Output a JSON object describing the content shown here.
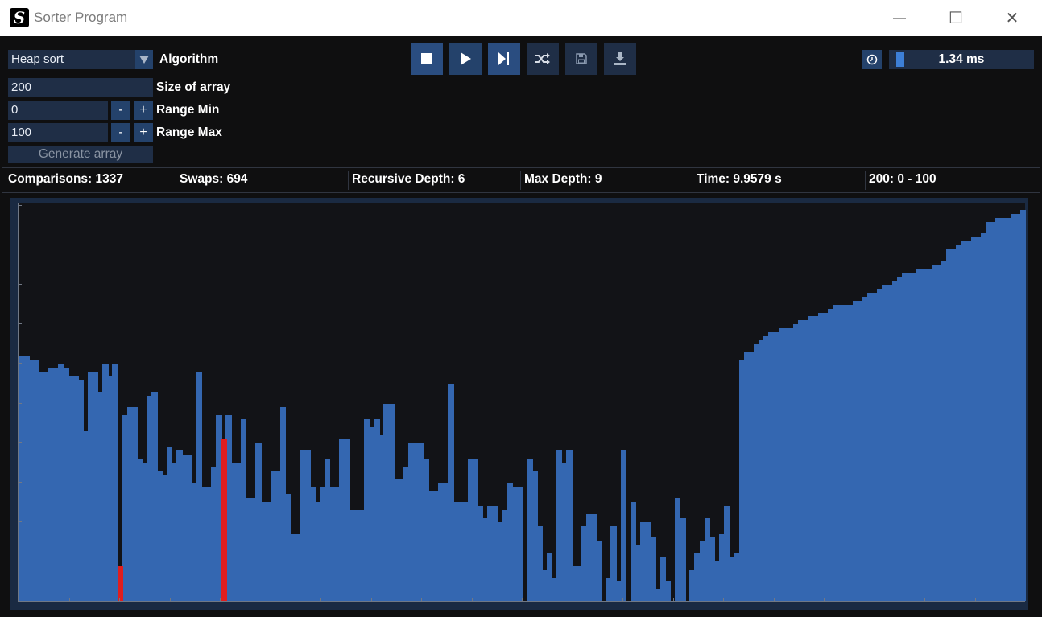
{
  "window": {
    "title": "Sorter Program",
    "minimize": "—",
    "maximize": "☐",
    "close": "✕",
    "app_icon_letter": "S"
  },
  "controls": {
    "algorithm": {
      "value": "Heap sort",
      "label": "Algorithm"
    },
    "size": {
      "value": "200",
      "label": "Size of array"
    },
    "range_min": {
      "value": "0",
      "label": "Range Min",
      "minus": "-",
      "plus": "+"
    },
    "range_max": {
      "value": "100",
      "label": "Range Max",
      "minus": "-",
      "plus": "+"
    },
    "generate": "Generate array"
  },
  "toolbar": {
    "icons": [
      "stop-icon",
      "play-icon",
      "step-icon",
      "shuffle-icon",
      "save-icon",
      "download-icon"
    ]
  },
  "delay": {
    "value": "1.34 ms",
    "fraction": 0.05
  },
  "stats": {
    "comparisons": "Comparisons: 1337",
    "swaps": "Swaps: 694",
    "recursive_depth": "Recursive Depth: 6",
    "max_depth": "Max Depth: 9",
    "time": "Time: 9.9579 s",
    "array_info": "200: 0 - 100"
  },
  "colors": {
    "bar": "#3467b1",
    "highlight": "#e01e1e",
    "background": "#121317",
    "accent": "#24426b"
  },
  "chart_data": {
    "type": "bar",
    "ylim": [
      0,
      100
    ],
    "highlighted_indices": [
      20,
      41
    ],
    "values": [
      62,
      62,
      61,
      61,
      58,
      58,
      59,
      59,
      60,
      59,
      57,
      57,
      56,
      43,
      58,
      58,
      53,
      60,
      57,
      60,
      9,
      47,
      49,
      49,
      36,
      35,
      52,
      53,
      33,
      32,
      39,
      35,
      38,
      37,
      37,
      30,
      58,
      29,
      29,
      34,
      47,
      41,
      47,
      35,
      35,
      46,
      26,
      26,
      40,
      25,
      25,
      33,
      33,
      49,
      27,
      17,
      17,
      38,
      38,
      29,
      25,
      29,
      36,
      29,
      29,
      41,
      41,
      23,
      23,
      23,
      46,
      44,
      46,
      42,
      50,
      50,
      31,
      31,
      34,
      40,
      40,
      40,
      36,
      28,
      28,
      30,
      30,
      55,
      25,
      25,
      25,
      36,
      36,
      24,
      21,
      24,
      24,
      20,
      23,
      30,
      29,
      29,
      0,
      36,
      33,
      19,
      8,
      12,
      6,
      38,
      35,
      38,
      9,
      9,
      19,
      22,
      22,
      15,
      0,
      6,
      19,
      5,
      38,
      0,
      25,
      14,
      20,
      20,
      16,
      3,
      11,
      5,
      0,
      26,
      21,
      0,
      8,
      12,
      15,
      21,
      16,
      10,
      17,
      24,
      11,
      12,
      61,
      63,
      63,
      65,
      66,
      67,
      68,
      68,
      69,
      69,
      69,
      70,
      71,
      71,
      72,
      72,
      73,
      73,
      74,
      75,
      75,
      75,
      75,
      76,
      76,
      77,
      78,
      78,
      79,
      80,
      80,
      81,
      82,
      83,
      83,
      83,
      84,
      84,
      84,
      85,
      85,
      86,
      89,
      89,
      90,
      91,
      91,
      92,
      92,
      93,
      96,
      96,
      97,
      97,
      97,
      98,
      98,
      99
    ]
  }
}
